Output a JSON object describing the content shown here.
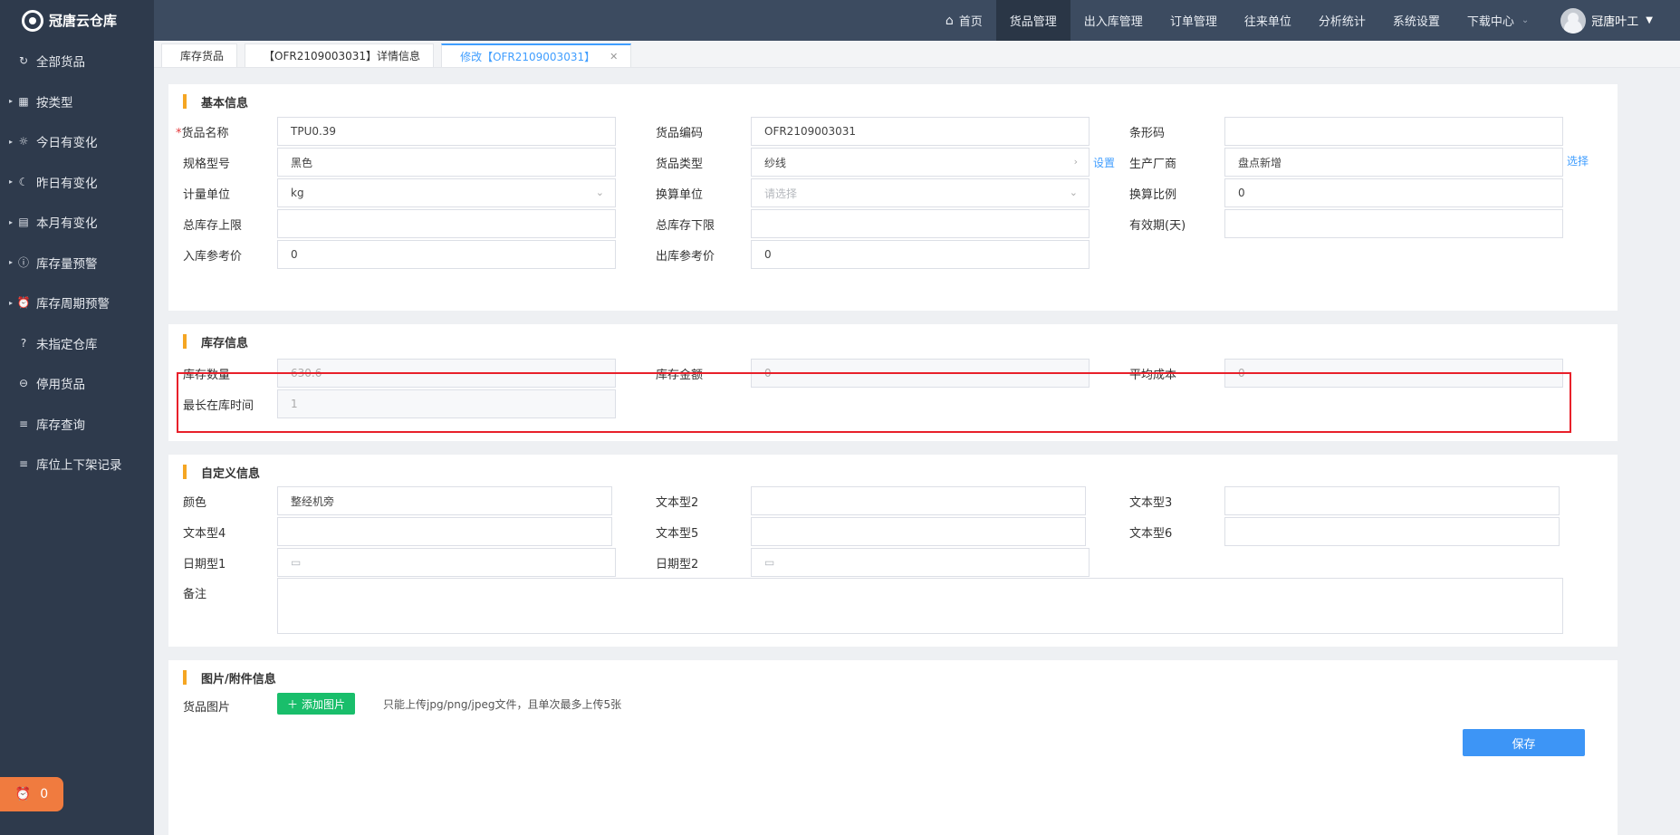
{
  "app": {
    "title": "冠唐云仓库"
  },
  "sidebar": {
    "items": [
      {
        "label": "全部货品",
        "icon": "refresh-icon",
        "glyph": "↻",
        "caret": ""
      },
      {
        "label": "按类型",
        "icon": "grid-icon",
        "glyph": "▦",
        "caret": "▸"
      },
      {
        "label": "今日有变化",
        "icon": "sun-icon",
        "glyph": "☼",
        "caret": "▸"
      },
      {
        "label": "昨日有变化",
        "icon": "moon-icon",
        "glyph": "☾",
        "caret": "▸"
      },
      {
        "label": "本月有变化",
        "icon": "calendar-icon",
        "glyph": "▤",
        "caret": "▸"
      },
      {
        "label": "库存量预警",
        "icon": "warning-icon",
        "glyph": "ⓘ",
        "caret": "▸"
      },
      {
        "label": "库存周期预警",
        "icon": "alarm-clock-icon",
        "glyph": "⏰",
        "caret": "▸"
      },
      {
        "label": "未指定仓库",
        "icon": "question-icon",
        "glyph": "?",
        "caret": ""
      },
      {
        "label": "停用货品",
        "icon": "disabled-icon",
        "glyph": "⊖",
        "caret": ""
      },
      {
        "label": "库存查询",
        "icon": "list-icon",
        "glyph": "≡",
        "caret": ""
      },
      {
        "label": "库位上下架记录",
        "icon": "list-icon",
        "glyph": "≡",
        "caret": ""
      }
    ],
    "alarm_count": "0"
  },
  "topnav": {
    "items": [
      "首页",
      "货品管理",
      "出入库管理",
      "订单管理",
      "往来单位",
      "分析统计",
      "系统设置",
      "下载中心"
    ],
    "active": "货品管理",
    "user": "冠唐叶工"
  },
  "tabs": [
    {
      "label": "库存货品",
      "active": false
    },
    {
      "label": "【OFR2109003031】详情信息",
      "active": false
    },
    {
      "label": "修改【OFR2109003031】",
      "active": true
    }
  ],
  "basic": {
    "title": "基本信息",
    "name_label": "货品名称",
    "name_value": "TPU0.39",
    "code_label": "货品编码",
    "code_value": "OFR2109003031",
    "barcode_label": "条形码",
    "barcode_value": "",
    "spec_label": "规格型号",
    "spec_value": "黑色",
    "type_label": "货品类型",
    "type_value": "纱线",
    "type_link": "设置",
    "maker_label": "生产厂商",
    "maker_value": "盘点新增",
    "maker_link": "选择",
    "unit_label": "计量单位",
    "unit_value": "kg",
    "conv_unit_label": "换算单位",
    "conv_unit_placeholder": "请选择",
    "conv_ratio_label": "换算比例",
    "conv_ratio_value": "0",
    "max_stock_label": "总库存上限",
    "max_stock_value": "",
    "min_stock_label": "总库存下限",
    "min_stock_value": "",
    "expiry_label": "有效期(天)",
    "expiry_value": "",
    "in_price_label": "入库参考价",
    "in_price_value": "0",
    "out_price_label": "出库参考价",
    "out_price_value": "0"
  },
  "stock": {
    "title": "库存信息",
    "qty_label": "库存数量",
    "qty_value": "630.6",
    "amount_label": "库存金额",
    "amount_value": "0",
    "avg_cost_label": "平均成本",
    "avg_cost_value": "0",
    "longest_label": "最长在库时间",
    "longest_value": "1"
  },
  "custom": {
    "title": "自定义信息",
    "color_label": "颜色",
    "color_value": "整经机旁",
    "text2_label": "文本型2",
    "text3_label": "文本型3",
    "text4_label": "文本型4",
    "text5_label": "文本型5",
    "text6_label": "文本型6",
    "date1_label": "日期型1",
    "date2_label": "日期型2",
    "remark_label": "备注"
  },
  "attachments": {
    "title": "图片/附件信息",
    "image_label": "货品图片",
    "add_button": "添加图片",
    "hint": "只能上传jpg/png/jpeg文件，且单次最多上传5张"
  },
  "actions": {
    "save": "保存"
  }
}
